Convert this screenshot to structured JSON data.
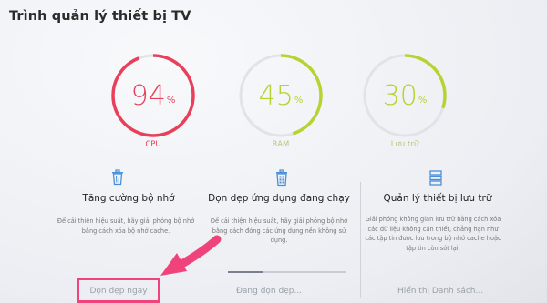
{
  "title": "Trình quản lý thiết bị TV",
  "gauges": [
    {
      "label": "CPU",
      "value": 94,
      "unit": "%",
      "color": "#e8405a",
      "label_color": "#e8405a"
    },
    {
      "label": "RAM",
      "value": 45,
      "unit": "%",
      "color": "#b8d233",
      "label_color": "#b6c77a"
    },
    {
      "label": "Lưu trữ",
      "value": 30,
      "unit": "%",
      "color": "#b8d233",
      "label_color": "#b6c77a"
    }
  ],
  "columns": [
    {
      "icon": "trash-icon",
      "title": "Tăng cường bộ nhớ",
      "desc_lines": [
        "Để cải thiện hiệu suất, hãy giải phóng bộ nhớ",
        "bằng cách xóa bộ nhớ cache."
      ],
      "action": "Dọn dẹp ngay"
    },
    {
      "icon": "apps-trash-icon",
      "title": "Dọn dẹp ứng dụng đang chạy",
      "desc_lines": [
        "Để cải thiện hiệu suất, hãy giải phóng bộ nhớ",
        "bằng cách đóng các ứng dụng nền không sử",
        "dụng."
      ],
      "action": "Đang dọn dẹp...",
      "progress": 0.3
    },
    {
      "icon": "storage-icon",
      "title": "Quản lý thiết bị lưu trữ",
      "desc_lines": [
        "Giải phóng không gian lưu trữ bằng cách xóa",
        "các dữ liệu không cần thiết, chẳng hạn như",
        "các tập tin được lưu trong bộ nhớ cache hoặc",
        "tập tin còn sót lại."
      ],
      "action": "Hiển thị Danh sách..."
    }
  ],
  "colors": {
    "accent": "#f0437b",
    "ring_track": "#e1e3e8"
  }
}
